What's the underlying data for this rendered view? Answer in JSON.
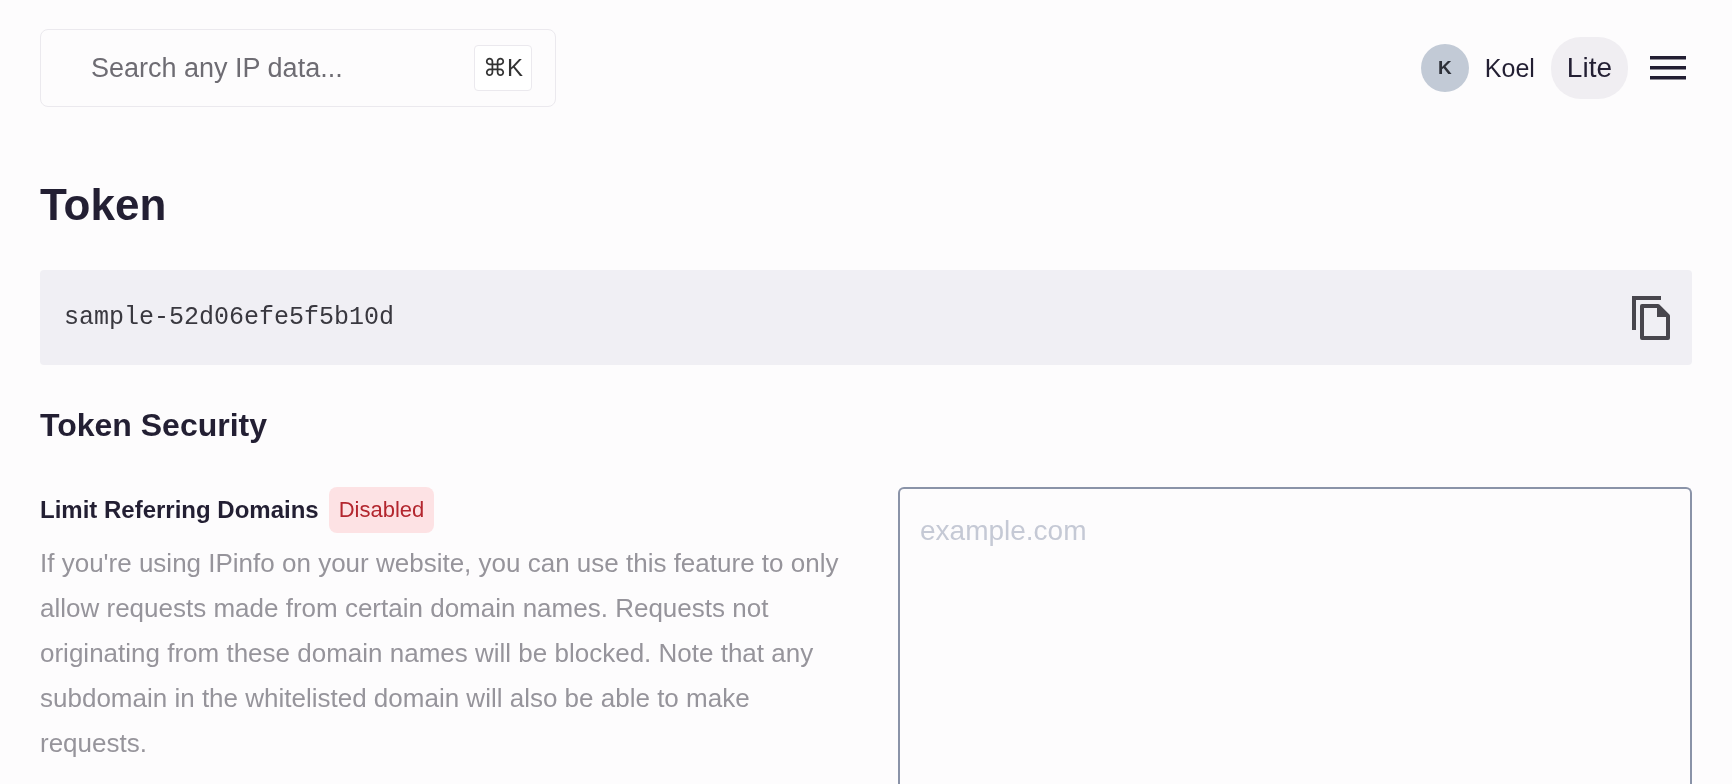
{
  "search": {
    "placeholder": "Search any IP data...",
    "shortcut": "⌘K"
  },
  "user": {
    "initial": "K",
    "name": "Koel",
    "plan": "Lite"
  },
  "title": "Token",
  "token": {
    "value": "sample-52d06efe5f5b10d"
  },
  "security": {
    "heading": "Token Security",
    "settings": [
      {
        "label": "Limit Referring Domains",
        "enabled": false,
        "status": "Disabled",
        "description": "If you're using IPinfo on your website, you can use this feature to only allow requests made from certain domain names. Requests not originating from these domain names will be blocked. Note that any subdomain in the whitelisted domain will also be able to make requests.",
        "placeholder": "example.com"
      }
    ]
  }
}
